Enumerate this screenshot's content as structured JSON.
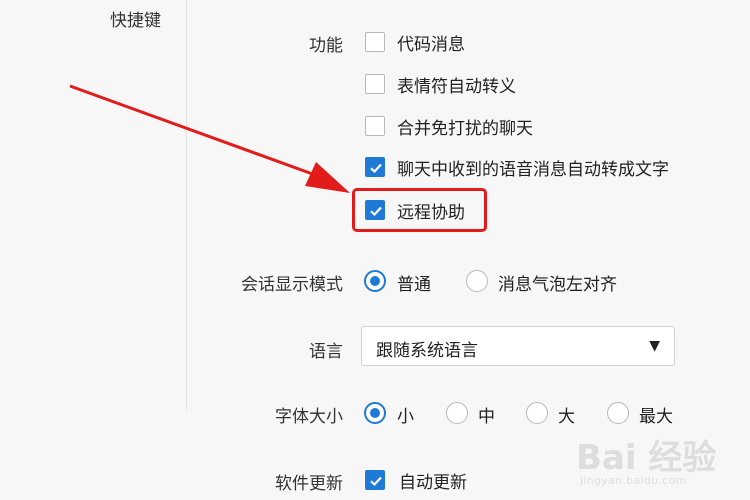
{
  "sidebar": {
    "item": "快捷键"
  },
  "features": {
    "label": "功能",
    "options": [
      {
        "label": "代码消息",
        "checked": false
      },
      {
        "label": "表情符自动转义",
        "checked": false
      },
      {
        "label": "合并免打扰的聊天",
        "checked": false
      },
      {
        "label": "聊天中收到的语音消息自动转成文字",
        "checked": true
      },
      {
        "label": "远程协助",
        "checked": true,
        "highlighted": true
      }
    ]
  },
  "display_mode": {
    "label": "会话显示模式",
    "options": [
      {
        "label": "普通",
        "selected": true
      },
      {
        "label": "消息气泡左对齐",
        "selected": false
      }
    ]
  },
  "language": {
    "label": "语言",
    "value": "跟随系统语言",
    "caret": "▼"
  },
  "font_size": {
    "label": "字体大小",
    "options": [
      {
        "label": "小",
        "selected": true
      },
      {
        "label": "中",
        "selected": false
      },
      {
        "label": "大",
        "selected": false
      },
      {
        "label": "最大",
        "selected": false
      }
    ]
  },
  "software_update": {
    "label": "软件更新",
    "option": {
      "label": "自动更新",
      "checked": true
    }
  },
  "watermark": {
    "brand": "Bai 经验",
    "url": "jingyan.baidu.com"
  },
  "colors": {
    "accent": "#1f7ad6",
    "annotation": "#e21b1b",
    "background": "#f7f7f7"
  }
}
